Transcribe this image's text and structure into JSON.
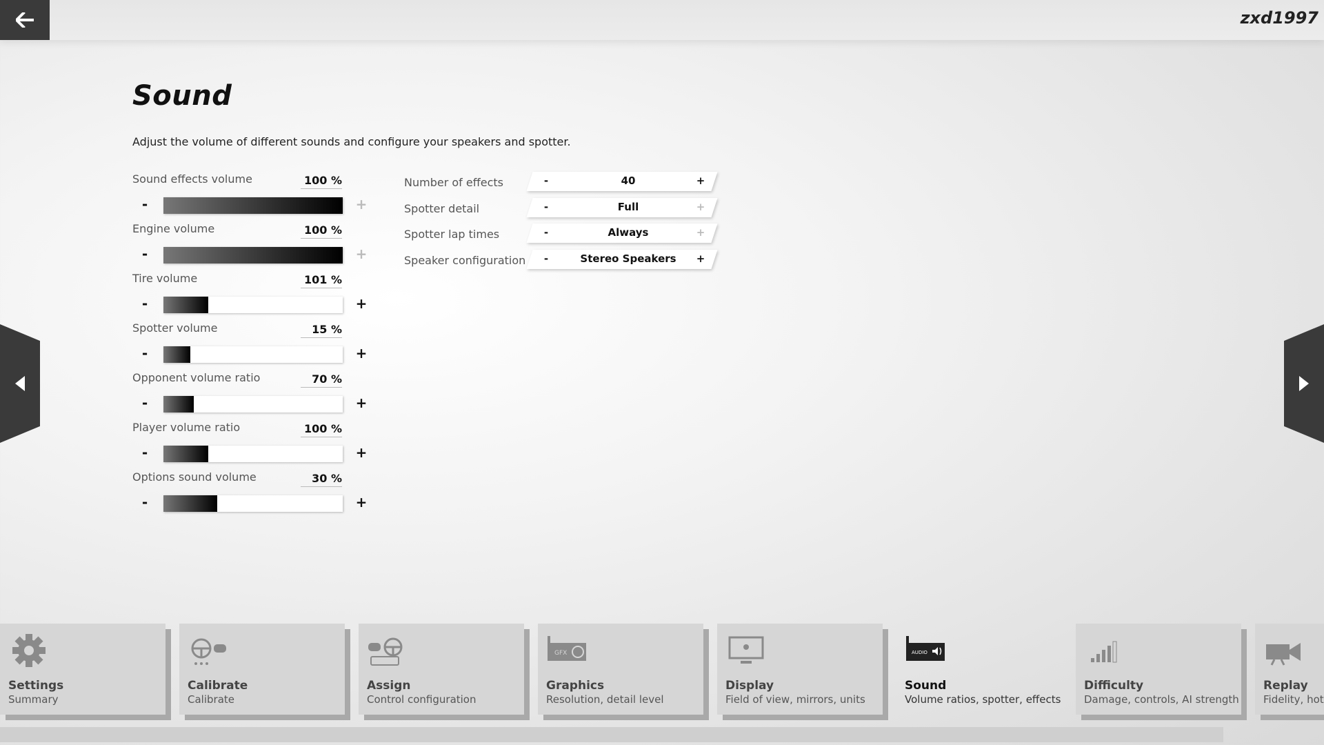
{
  "header": {
    "username": "zxd1997"
  },
  "page": {
    "title": "Sound",
    "description": "Adjust the volume of different sounds and configure your speakers and spotter."
  },
  "volumes": [
    {
      "label": "Sound effects volume",
      "value": "100 %",
      "level": 1.0,
      "plus_enabled": false
    },
    {
      "label": "Engine volume",
      "value": "100 %",
      "level": 1.0,
      "plus_enabled": false
    },
    {
      "label": "Tire volume",
      "value": "101 %",
      "level": 0.25,
      "plus_enabled": true
    },
    {
      "label": "Spotter volume",
      "value": "15 %",
      "level": 0.15,
      "plus_enabled": true
    },
    {
      "label": "Opponent volume ratio",
      "value": "70 %",
      "level": 0.17,
      "plus_enabled": true
    },
    {
      "label": "Player volume ratio",
      "value": "100 %",
      "level": 0.25,
      "plus_enabled": true
    },
    {
      "label": "Options sound volume",
      "value": "30 %",
      "level": 0.3,
      "plus_enabled": true
    }
  ],
  "controls": {
    "minus": "-",
    "plus": "+"
  },
  "options": [
    {
      "label": "Number of effects",
      "value": "40",
      "plus_enabled": true
    },
    {
      "label": "Spotter detail",
      "value": "Full",
      "plus_enabled": false
    },
    {
      "label": "Spotter lap times",
      "value": "Always",
      "plus_enabled": false
    },
    {
      "label": "Speaker configuration",
      "value": "Stereo Speakers",
      "plus_enabled": true
    }
  ],
  "tabs": [
    {
      "title": "Settings",
      "subtitle": "Summary",
      "icon": "gear-icon"
    },
    {
      "title": "Calibrate",
      "subtitle": "Calibrate",
      "icon": "wheel-gamepad-icon"
    },
    {
      "title": "Assign",
      "subtitle": "Control configuration",
      "icon": "controls-icon"
    },
    {
      "title": "Graphics",
      "subtitle": "Resolution, detail level",
      "icon": "gfx-card-icon"
    },
    {
      "title": "Display",
      "subtitle": "Field of view, mirrors, units",
      "icon": "monitor-icon"
    },
    {
      "title": "Sound",
      "subtitle": "Volume ratios, spotter, effects",
      "icon": "audio-card-icon",
      "icon_text": "AUDIO",
      "active": true
    },
    {
      "title": "Difficulty",
      "subtitle": "Damage, controls, AI strength",
      "icon": "signal-bars-icon"
    },
    {
      "title": "Replay",
      "subtitle": "Fidelity, hot l",
      "icon": "camera-icon"
    }
  ],
  "icon_texts": {
    "gfx": "GFX",
    "audio": "AUDIO"
  }
}
